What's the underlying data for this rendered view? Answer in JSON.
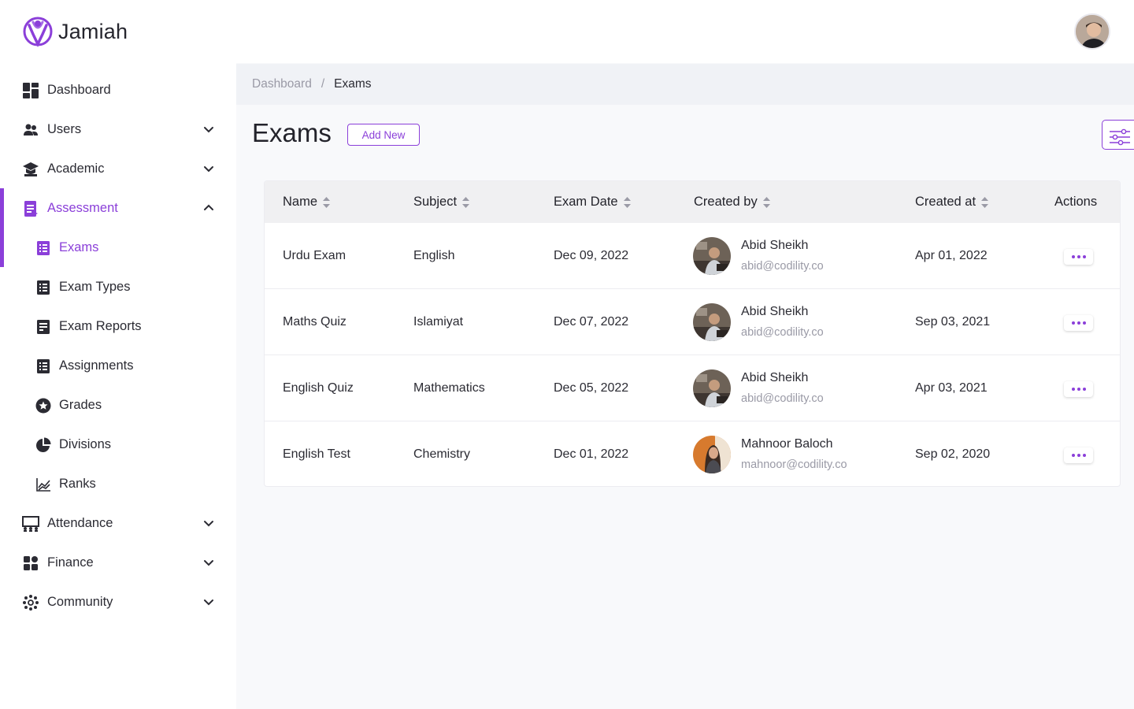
{
  "app": {
    "name": "Jamiah"
  },
  "colors": {
    "accent": "#8b3fd9",
    "text": "#2b2b33",
    "muted": "#9a9aa6"
  },
  "sidebar": {
    "items": [
      {
        "label": "Dashboard",
        "icon": "dashboard-grid-icon"
      },
      {
        "label": "Users",
        "icon": "users-icon",
        "expandable": true
      },
      {
        "label": "Academic",
        "icon": "graduation-cap-icon",
        "expandable": true
      },
      {
        "label": "Assessment",
        "icon": "clipboard-list-icon",
        "expandable": true,
        "expanded": true,
        "active": true,
        "children": [
          {
            "label": "Exams",
            "icon": "list-icon",
            "active": true
          },
          {
            "label": "Exam Types",
            "icon": "list-icon"
          },
          {
            "label": "Exam Reports",
            "icon": "report-icon"
          },
          {
            "label": "Assignments",
            "icon": "list-icon"
          },
          {
            "label": "Grades",
            "icon": "star-circle-icon"
          },
          {
            "label": "Divisions",
            "icon": "pie-chart-icon"
          },
          {
            "label": "Ranks",
            "icon": "line-chart-icon"
          }
        ]
      },
      {
        "label": "Attendance",
        "icon": "attendance-icon",
        "expandable": true
      },
      {
        "label": "Finance",
        "icon": "apps-icon",
        "expandable": true
      },
      {
        "label": "Community",
        "icon": "community-icon",
        "expandable": true
      }
    ]
  },
  "breadcrumb": {
    "root": "Dashboard",
    "separator": "/",
    "current": "Exams"
  },
  "page": {
    "title": "Exams",
    "add_new_label": "Add New"
  },
  "table": {
    "columns": [
      "Name",
      "Subject",
      "Exam Date",
      "Created by",
      "Created at",
      "Actions"
    ],
    "rows": [
      {
        "name": "Urdu Exam",
        "subject": "English",
        "exam_date": "Dec 09, 2022",
        "creator_name": "Abid Sheikh",
        "creator_email": "abid@codility.co",
        "created_at": "Apr 01, 2022"
      },
      {
        "name": "Maths Quiz",
        "subject": "Islamiyat",
        "exam_date": "Dec 07, 2022",
        "creator_name": "Abid Sheikh",
        "creator_email": "abid@codility.co",
        "created_at": "Sep 03, 2021"
      },
      {
        "name": "English Quiz",
        "subject": "Mathematics",
        "exam_date": "Dec 05, 2022",
        "creator_name": "Abid Sheikh",
        "creator_email": "abid@codility.co",
        "created_at": "Apr 03, 2021"
      },
      {
        "name": "English Test",
        "subject": "Chemistry",
        "exam_date": "Dec 01, 2022",
        "creator_name": "Mahnoor Baloch",
        "creator_email": "mahnoor@codility.co",
        "created_at": "Sep 02, 2020"
      }
    ]
  }
}
